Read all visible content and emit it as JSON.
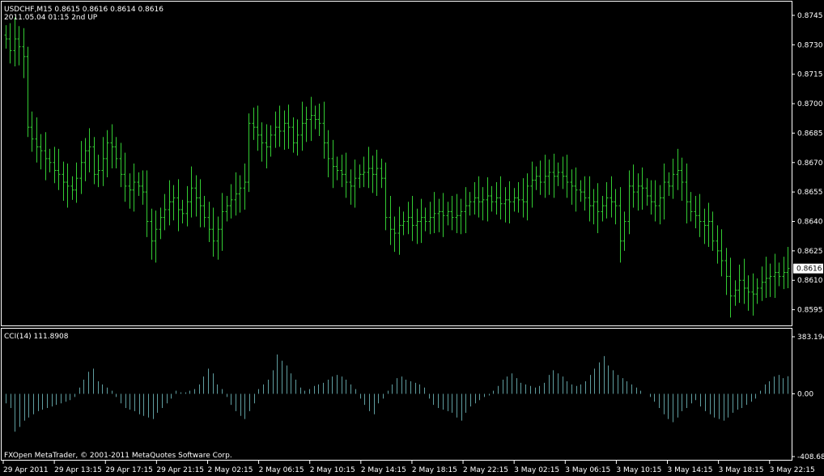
{
  "header": {
    "symbol_line": "USDCHF,M15  0.8615 0.8616 0.8614 0.8616",
    "date_line": "2011.05.04 01:15  2nd UP"
  },
  "indicator": {
    "label": "CCI(14) 111.8908"
  },
  "footer": {
    "copyright": "FXOpen MetaTrader, © 2001-2011 MetaQuotes Software Corp."
  },
  "colors": {
    "background": "#000000",
    "bars": "#33cc33",
    "cci": "#5f9ea0",
    "grid": "#ffffff",
    "text": "#ffffff"
  },
  "chart_data": [
    {
      "type": "bar",
      "style": "ohlc",
      "y_ticks": [
        "0.8745",
        "0.8730",
        "0.8715",
        "0.8700",
        "0.8685",
        "0.8670",
        "0.8655",
        "0.8640",
        "0.8625",
        "0.8610",
        "0.8595"
      ],
      "current_price": "0.8616",
      "ylim": [
        0.8587,
        0.8752
      ],
      "x_ticks": [
        "29 Apr 2011",
        "29 Apr 13:15",
        "29 Apr 17:15",
        "29 Apr 21:15",
        "2 May 02:15",
        "2 May 06:15",
        "2 May 10:15",
        "2 May 14:15",
        "2 May 18:15",
        "2 May 22:15",
        "3 May 02:15",
        "3 May 06:15",
        "3 May 10:15",
        "3 May 14:15",
        "3 May 18:15",
        "3 May 22:15"
      ],
      "closes": [
        0.8733,
        0.8727,
        0.8733,
        0.8729,
        0.8724,
        0.8688,
        0.8682,
        0.8678,
        0.8676,
        0.8672,
        0.867,
        0.8666,
        0.8664,
        0.866,
        0.8658,
        0.8656,
        0.8662,
        0.867,
        0.8676,
        0.8678,
        0.8664,
        0.8666,
        0.8672,
        0.868,
        0.8678,
        0.8672,
        0.8664,
        0.8658,
        0.8656,
        0.866,
        0.8658,
        0.8655,
        0.864,
        0.863,
        0.8636,
        0.8642,
        0.8646,
        0.865,
        0.8652,
        0.8646,
        0.8644,
        0.865,
        0.8657,
        0.8652,
        0.8648,
        0.8642,
        0.8636,
        0.863,
        0.8636,
        0.8645,
        0.8648,
        0.8651,
        0.8654,
        0.8657,
        0.866,
        0.869,
        0.8688,
        0.8684,
        0.868,
        0.8678,
        0.8684,
        0.8688,
        0.8686,
        0.869,
        0.8688,
        0.868,
        0.8684,
        0.869,
        0.8692,
        0.8694,
        0.8692,
        0.869,
        0.868,
        0.8672,
        0.8668,
        0.8666,
        0.8664,
        0.866,
        0.8658,
        0.8662,
        0.8664,
        0.8665,
        0.8667,
        0.8664,
        0.8667,
        0.8662,
        0.8642,
        0.8636,
        0.8634,
        0.8638,
        0.864,
        0.8642,
        0.8638,
        0.864,
        0.8642,
        0.864,
        0.8642,
        0.8644,
        0.8645,
        0.8643,
        0.8645,
        0.8642,
        0.8643,
        0.8645,
        0.8648,
        0.865,
        0.8652,
        0.865,
        0.8651,
        0.8653,
        0.865,
        0.8652,
        0.8649,
        0.8651,
        0.865,
        0.8652,
        0.8651,
        0.865,
        0.8658,
        0.8661,
        0.8663,
        0.866,
        0.8663,
        0.8665,
        0.8663,
        0.8665,
        0.8663,
        0.866,
        0.8658,
        0.8656,
        0.8655,
        0.8652,
        0.8648,
        0.865,
        0.8645,
        0.8648,
        0.8652,
        0.865,
        0.8648,
        0.863,
        0.864,
        0.8658,
        0.8655,
        0.8658,
        0.8657,
        0.8653,
        0.865,
        0.8648,
        0.8652,
        0.866,
        0.8658,
        0.8664,
        0.8666,
        0.866,
        0.865,
        0.8645,
        0.8643,
        0.864,
        0.8638,
        0.864,
        0.863,
        0.8625,
        0.862,
        0.8612,
        0.8602,
        0.8605,
        0.861,
        0.8606,
        0.8604,
        0.8603,
        0.8606,
        0.8609,
        0.8611,
        0.8612,
        0.8614,
        0.8612,
        0.8614,
        0.8616
      ]
    },
    {
      "type": "bar",
      "name": "CCI(14)",
      "last_value": "111.8908",
      "y_ticks": [
        "383.1940",
        "0.00",
        "-408.6890"
      ],
      "ylim": [
        -408.689,
        383.194
      ],
      "values": [
        -60,
        -90,
        -240,
        -210,
        -170,
        -150,
        -130,
        -110,
        -100,
        -90,
        -80,
        -70,
        -60,
        -50,
        -40,
        -20,
        40,
        90,
        140,
        160,
        80,
        60,
        40,
        20,
        -20,
        -60,
        -90,
        -100,
        -110,
        -130,
        -140,
        -150,
        -160,
        -120,
        -90,
        -60,
        -30,
        20,
        10,
        10,
        20,
        30,
        60,
        110,
        160,
        130,
        60,
        30,
        -20,
        -70,
        -110,
        -140,
        -160,
        -110,
        -60,
        30,
        60,
        90,
        150,
        250,
        210,
        180,
        130,
        90,
        40,
        20,
        30,
        50,
        60,
        70,
        90,
        110,
        120,
        110,
        90,
        60,
        30,
        -30,
        -70,
        -110,
        -130,
        -60,
        -30,
        20,
        60,
        100,
        110,
        90,
        80,
        70,
        60,
        40,
        -30,
        -70,
        -90,
        -100,
        -110,
        -120,
        -150,
        -170,
        -120,
        -80,
        -60,
        -40,
        -20,
        -10,
        20,
        50,
        90,
        110,
        130,
        100,
        70,
        60,
        50,
        40,
        50,
        70,
        120,
        150,
        130,
        110,
        80,
        60,
        50,
        60,
        80,
        120,
        160,
        200,
        240,
        180,
        150,
        120,
        100,
        80,
        60,
        40,
        20,
        0,
        -20,
        -50,
        -90,
        -130,
        -160,
        -180,
        -150,
        -110,
        -90,
        -60,
        -40,
        -80,
        -110,
        -130,
        -150,
        -160,
        -170,
        -150,
        -120,
        -100,
        -90,
        -70,
        -50,
        -30,
        20,
        60,
        80,
        110,
        120,
        100,
        111.8908
      ]
    }
  ]
}
